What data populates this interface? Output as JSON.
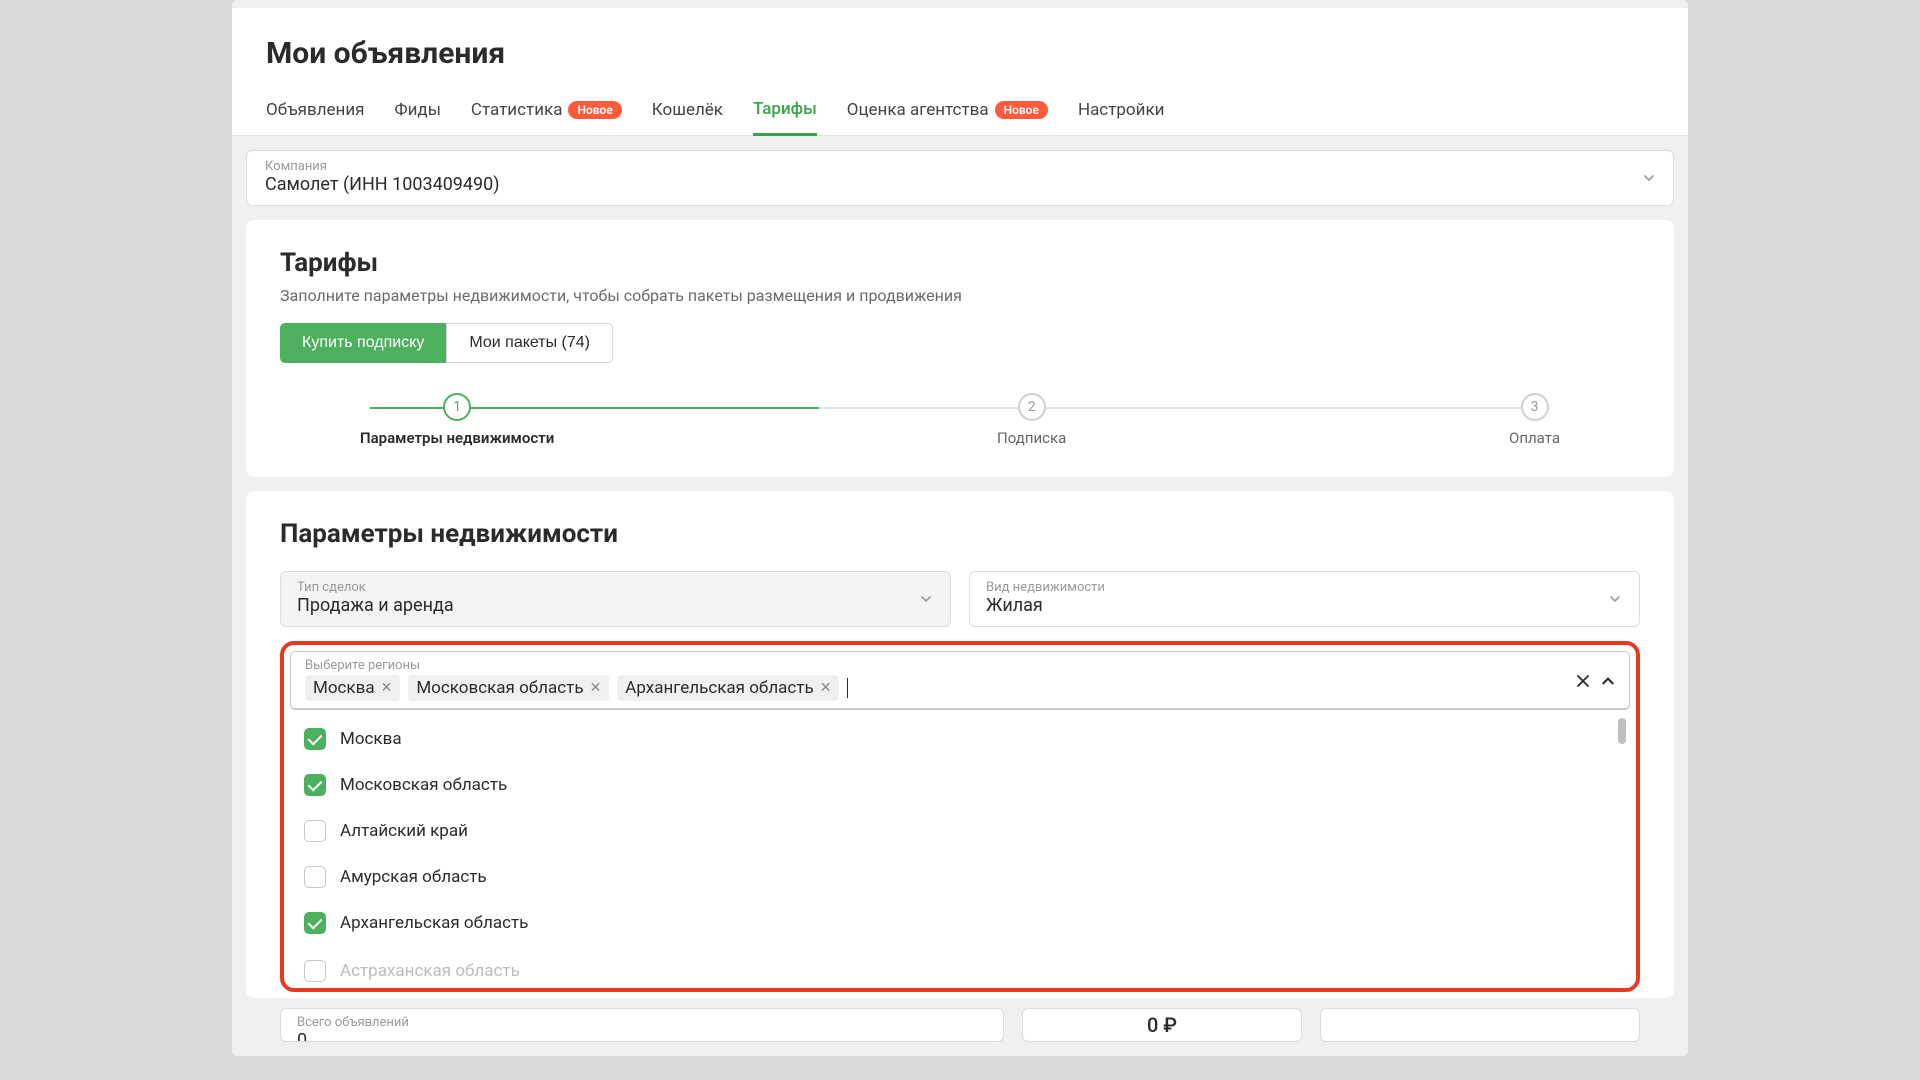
{
  "page_title": "Мои объявления",
  "tabs": [
    {
      "label": "Объявления",
      "badge": null,
      "active": false
    },
    {
      "label": "Фиды",
      "badge": null,
      "active": false
    },
    {
      "label": "Статистика",
      "badge": "Новое",
      "active": false
    },
    {
      "label": "Кошелёк",
      "badge": null,
      "active": false
    },
    {
      "label": "Тарифы",
      "badge": null,
      "active": true
    },
    {
      "label": "Оценка агентства",
      "badge": "Новое",
      "active": false
    },
    {
      "label": "Настройки",
      "badge": null,
      "active": false
    }
  ],
  "company": {
    "label": "Компания",
    "value": "Самолет (ИНН 1003409490)"
  },
  "tariffs": {
    "title": "Тарифы",
    "subtitle": "Заполните параметры недвижимости, чтобы собрать пакеты размещения и продвижения",
    "buy_btn": "Купить подписку",
    "my_packages_btn": "Мои пакеты (74)",
    "steps": [
      {
        "num": "1",
        "label": "Параметры недвижимости",
        "active": true
      },
      {
        "num": "2",
        "label": "Подписка",
        "active": false
      },
      {
        "num": "3",
        "label": "Оплата",
        "active": false
      }
    ]
  },
  "params": {
    "title": "Параметры недвижимости",
    "deal_type": {
      "label": "Тип сделок",
      "value": "Продажа и аренда"
    },
    "property_kind": {
      "label": "Вид недвижимости",
      "value": "Жилая"
    },
    "regions": {
      "label": "Выберите регионы",
      "selected": [
        "Москва",
        "Московская область",
        "Архангельская область"
      ],
      "options": [
        {
          "label": "Москва",
          "checked": true
        },
        {
          "label": "Московская область",
          "checked": true
        },
        {
          "label": "Алтайский край",
          "checked": false
        },
        {
          "label": "Амурская область",
          "checked": false
        },
        {
          "label": "Архангельская область",
          "checked": true
        }
      ],
      "overflow": "Астраханская область"
    }
  },
  "bottom": {
    "total_label": "Всего объявлений",
    "total_value": "0",
    "price": "0 ₽"
  },
  "colors": {
    "accent": "#4db05e",
    "highlight": "#e63a1e",
    "badge": "#ff5a3c"
  }
}
